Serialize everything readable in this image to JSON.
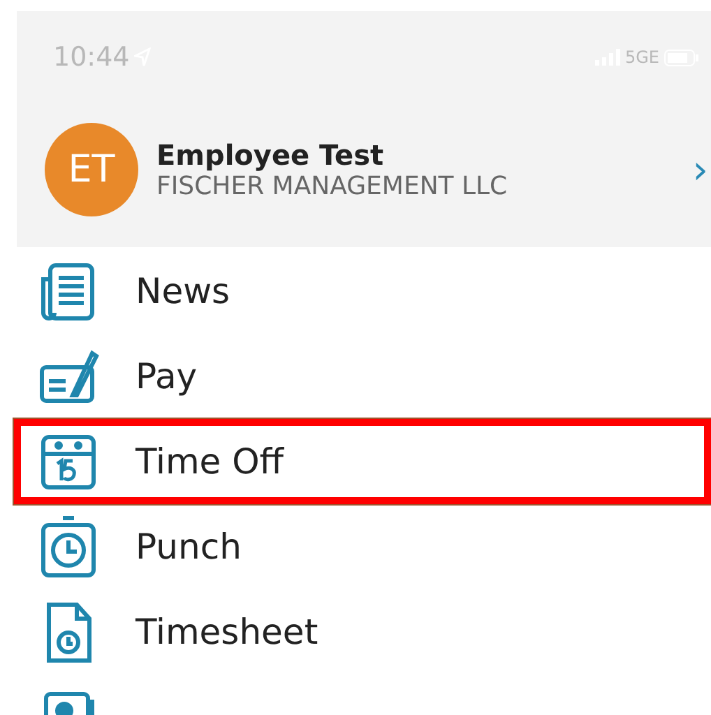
{
  "status_bar": {
    "time": "10:44",
    "network": "5GE"
  },
  "profile": {
    "initials": "ET",
    "name": "Employee Test",
    "company": "FISCHER MANAGEMENT LLC",
    "chevron": "›"
  },
  "menu": [
    {
      "kind": "news",
      "label": "News",
      "selected": false
    },
    {
      "kind": "pay",
      "label": "Pay",
      "selected": false
    },
    {
      "kind": "timeoff",
      "label": "Time Off",
      "selected": true
    },
    {
      "kind": "punch",
      "label": "Punch",
      "selected": false
    },
    {
      "kind": "timesheet",
      "label": "Timesheet",
      "selected": false
    },
    {
      "kind": "directory",
      "selected": false
    }
  ]
}
